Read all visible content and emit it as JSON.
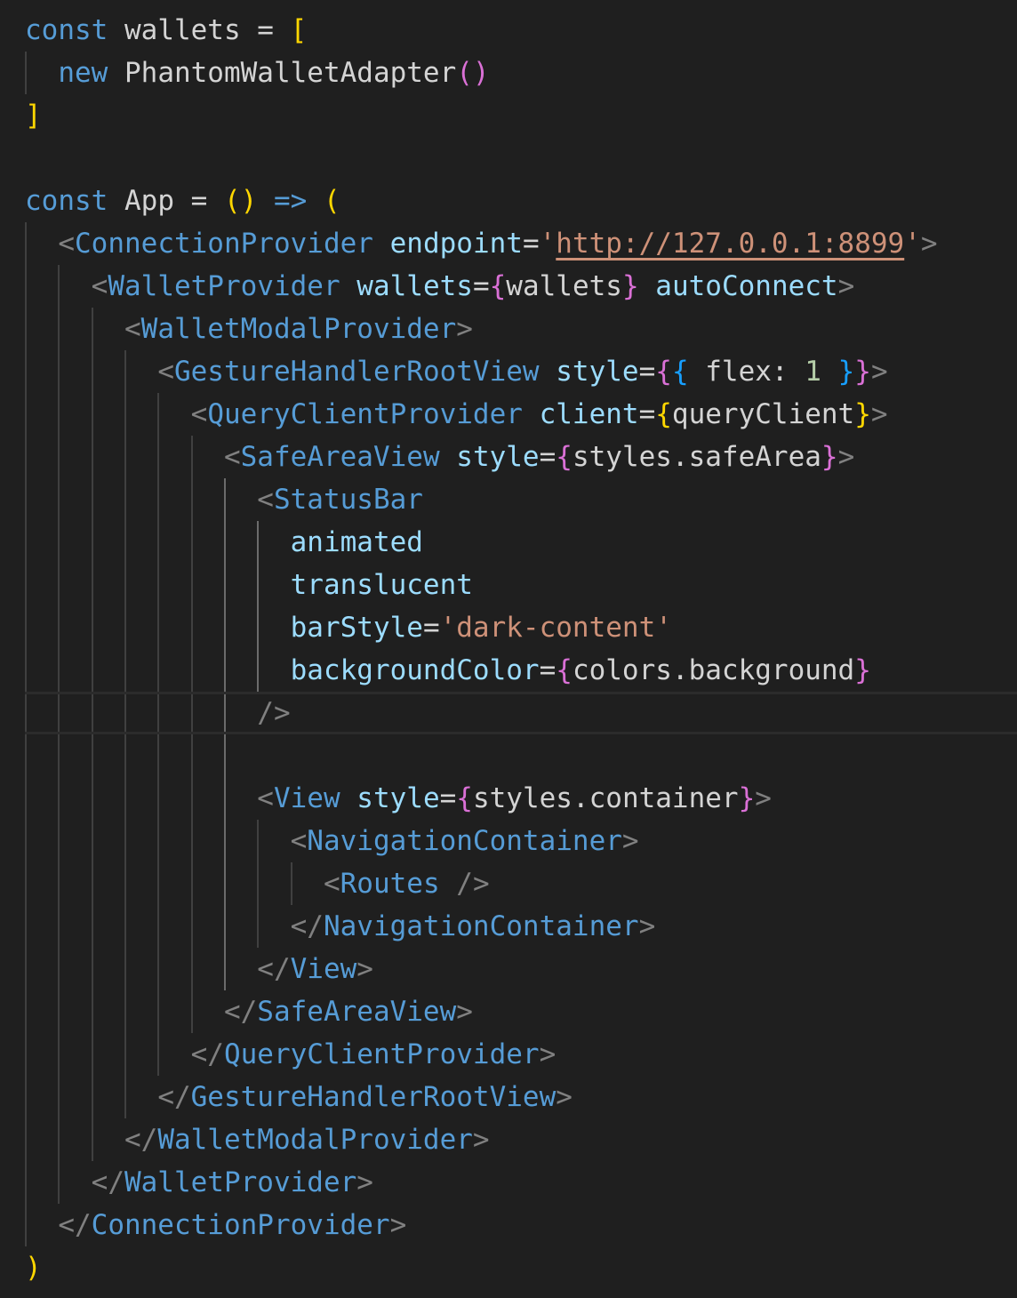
{
  "editor": {
    "theme_colors": {
      "background": "#1f1f1f",
      "keyword": "#569cd6",
      "tag": "#569cd6",
      "attribute": "#9cdcfe",
      "string": "#ce9178",
      "bracket_level1": "#ffd700",
      "bracket_level2": "#da70d6",
      "bracket_level3": "#179fff",
      "number": "#b5cea8",
      "punctuation": "#808080",
      "text": "#d4d4d4"
    },
    "current_line": 17,
    "lines": [
      {
        "tokens": [
          {
            "t": "kw",
            "v": "const"
          },
          {
            "t": "plain",
            "v": " wallets = "
          },
          {
            "t": "br1",
            "v": "["
          }
        ]
      },
      {
        "tokens": [
          {
            "t": "plain",
            "v": "  "
          },
          {
            "t": "kw",
            "v": "new"
          },
          {
            "t": "plain",
            "v": " PhantomWalletAdapter"
          },
          {
            "t": "br2",
            "v": "()"
          }
        ]
      },
      {
        "tokens": [
          {
            "t": "br1",
            "v": "]"
          }
        ]
      },
      {
        "tokens": []
      },
      {
        "tokens": [
          {
            "t": "kw",
            "v": "const"
          },
          {
            "t": "plain",
            "v": " App = "
          },
          {
            "t": "br1",
            "v": "()"
          },
          {
            "t": "kw",
            "v": " =>"
          },
          {
            "t": "plain",
            "v": " "
          },
          {
            "t": "br1",
            "v": "("
          }
        ]
      },
      {
        "tokens": [
          {
            "t": "plain",
            "v": "  "
          },
          {
            "t": "punct",
            "v": "<"
          },
          {
            "t": "tag",
            "v": "ConnectionProvider"
          },
          {
            "t": "plain",
            "v": " "
          },
          {
            "t": "attr",
            "v": "endpoint"
          },
          {
            "t": "plain",
            "v": "="
          },
          {
            "t": "str",
            "v": "'"
          },
          {
            "t": "str-u",
            "v": "http://127.0.0.1:8899"
          },
          {
            "t": "str",
            "v": "'"
          },
          {
            "t": "punct",
            "v": ">"
          }
        ]
      },
      {
        "tokens": [
          {
            "t": "plain",
            "v": "    "
          },
          {
            "t": "punct",
            "v": "<"
          },
          {
            "t": "tag",
            "v": "WalletProvider"
          },
          {
            "t": "plain",
            "v": " "
          },
          {
            "t": "attr",
            "v": "wallets"
          },
          {
            "t": "plain",
            "v": "="
          },
          {
            "t": "br2",
            "v": "{"
          },
          {
            "t": "plain",
            "v": "wallets"
          },
          {
            "t": "br2",
            "v": "}"
          },
          {
            "t": "plain",
            "v": " "
          },
          {
            "t": "attr",
            "v": "autoConnect"
          },
          {
            "t": "punct",
            "v": ">"
          }
        ]
      },
      {
        "tokens": [
          {
            "t": "plain",
            "v": "      "
          },
          {
            "t": "punct",
            "v": "<"
          },
          {
            "t": "tag",
            "v": "WalletModalProvider"
          },
          {
            "t": "punct",
            "v": ">"
          }
        ]
      },
      {
        "tokens": [
          {
            "t": "plain",
            "v": "        "
          },
          {
            "t": "punct",
            "v": "<"
          },
          {
            "t": "tag",
            "v": "GestureHandlerRootView"
          },
          {
            "t": "plain",
            "v": " "
          },
          {
            "t": "attr",
            "v": "style"
          },
          {
            "t": "plain",
            "v": "="
          },
          {
            "t": "br2",
            "v": "{"
          },
          {
            "t": "br3",
            "v": "{"
          },
          {
            "t": "plain",
            "v": " flex: "
          },
          {
            "t": "num",
            "v": "1"
          },
          {
            "t": "plain",
            "v": " "
          },
          {
            "t": "br3",
            "v": "}"
          },
          {
            "t": "br2",
            "v": "}"
          },
          {
            "t": "punct",
            "v": ">"
          }
        ]
      },
      {
        "tokens": [
          {
            "t": "plain",
            "v": "          "
          },
          {
            "t": "punct",
            "v": "<"
          },
          {
            "t": "tag",
            "v": "QueryClientProvider"
          },
          {
            "t": "plain",
            "v": " "
          },
          {
            "t": "attr",
            "v": "client"
          },
          {
            "t": "plain",
            "v": "="
          },
          {
            "t": "br1",
            "v": "{"
          },
          {
            "t": "plain",
            "v": "queryClient"
          },
          {
            "t": "br1",
            "v": "}"
          },
          {
            "t": "punct",
            "v": ">"
          }
        ]
      },
      {
        "tokens": [
          {
            "t": "plain",
            "v": "            "
          },
          {
            "t": "punct",
            "v": "<"
          },
          {
            "t": "tag",
            "v": "SafeAreaView"
          },
          {
            "t": "plain",
            "v": " "
          },
          {
            "t": "attr",
            "v": "style"
          },
          {
            "t": "plain",
            "v": "="
          },
          {
            "t": "br2",
            "v": "{"
          },
          {
            "t": "plain",
            "v": "styles.safeArea"
          },
          {
            "t": "br2",
            "v": "}"
          },
          {
            "t": "punct",
            "v": ">"
          }
        ]
      },
      {
        "tokens": [
          {
            "t": "plain",
            "v": "              "
          },
          {
            "t": "punct",
            "v": "<"
          },
          {
            "t": "tag",
            "v": "StatusBar"
          }
        ]
      },
      {
        "tokens": [
          {
            "t": "plain",
            "v": "                "
          },
          {
            "t": "attr",
            "v": "animated"
          }
        ]
      },
      {
        "tokens": [
          {
            "t": "plain",
            "v": "                "
          },
          {
            "t": "attr",
            "v": "translucent"
          }
        ]
      },
      {
        "tokens": [
          {
            "t": "plain",
            "v": "                "
          },
          {
            "t": "attr",
            "v": "barStyle"
          },
          {
            "t": "plain",
            "v": "="
          },
          {
            "t": "str",
            "v": "'dark-content'"
          }
        ]
      },
      {
        "tokens": [
          {
            "t": "plain",
            "v": "                "
          },
          {
            "t": "attr",
            "v": "backgroundColor"
          },
          {
            "t": "plain",
            "v": "="
          },
          {
            "t": "br2",
            "v": "{"
          },
          {
            "t": "plain",
            "v": "colors.background"
          },
          {
            "t": "br2",
            "v": "}"
          }
        ]
      },
      {
        "tokens": [
          {
            "t": "plain",
            "v": "              "
          },
          {
            "t": "punct",
            "v": "/>"
          }
        ]
      },
      {
        "tokens": []
      },
      {
        "tokens": [
          {
            "t": "plain",
            "v": "              "
          },
          {
            "t": "punct",
            "v": "<"
          },
          {
            "t": "tag",
            "v": "View"
          },
          {
            "t": "plain",
            "v": " "
          },
          {
            "t": "attr",
            "v": "style"
          },
          {
            "t": "plain",
            "v": "="
          },
          {
            "t": "br2",
            "v": "{"
          },
          {
            "t": "plain",
            "v": "styles.container"
          },
          {
            "t": "br2",
            "v": "}"
          },
          {
            "t": "punct",
            "v": ">"
          }
        ]
      },
      {
        "tokens": [
          {
            "t": "plain",
            "v": "                "
          },
          {
            "t": "punct",
            "v": "<"
          },
          {
            "t": "tag",
            "v": "NavigationContainer"
          },
          {
            "t": "punct",
            "v": ">"
          }
        ]
      },
      {
        "tokens": [
          {
            "t": "plain",
            "v": "                  "
          },
          {
            "t": "punct",
            "v": "<"
          },
          {
            "t": "tag",
            "v": "Routes"
          },
          {
            "t": "plain",
            "v": " "
          },
          {
            "t": "punct",
            "v": "/>"
          }
        ]
      },
      {
        "tokens": [
          {
            "t": "plain",
            "v": "                "
          },
          {
            "t": "punct",
            "v": "</"
          },
          {
            "t": "tag",
            "v": "NavigationContainer"
          },
          {
            "t": "punct",
            "v": ">"
          }
        ]
      },
      {
        "tokens": [
          {
            "t": "plain",
            "v": "              "
          },
          {
            "t": "punct",
            "v": "</"
          },
          {
            "t": "tag",
            "v": "View"
          },
          {
            "t": "punct",
            "v": ">"
          }
        ]
      },
      {
        "tokens": [
          {
            "t": "plain",
            "v": "            "
          },
          {
            "t": "punct",
            "v": "</"
          },
          {
            "t": "tag",
            "v": "SafeAreaView"
          },
          {
            "t": "punct",
            "v": ">"
          }
        ]
      },
      {
        "tokens": [
          {
            "t": "plain",
            "v": "          "
          },
          {
            "t": "punct",
            "v": "</"
          },
          {
            "t": "tag",
            "v": "QueryClientProvider"
          },
          {
            "t": "punct",
            "v": ">"
          }
        ]
      },
      {
        "tokens": [
          {
            "t": "plain",
            "v": "        "
          },
          {
            "t": "punct",
            "v": "</"
          },
          {
            "t": "tag",
            "v": "GestureHandlerRootView"
          },
          {
            "t": "punct",
            "v": ">"
          }
        ]
      },
      {
        "tokens": [
          {
            "t": "plain",
            "v": "      "
          },
          {
            "t": "punct",
            "v": "</"
          },
          {
            "t": "tag",
            "v": "WalletModalProvider"
          },
          {
            "t": "punct",
            "v": ">"
          }
        ]
      },
      {
        "tokens": [
          {
            "t": "plain",
            "v": "    "
          },
          {
            "t": "punct",
            "v": "</"
          },
          {
            "t": "tag",
            "v": "WalletProvider"
          },
          {
            "t": "punct",
            "v": ">"
          }
        ]
      },
      {
        "tokens": [
          {
            "t": "plain",
            "v": "  "
          },
          {
            "t": "punct",
            "v": "</"
          },
          {
            "t": "tag",
            "v": "ConnectionProvider"
          },
          {
            "t": "punct",
            "v": ">"
          }
        ]
      },
      {
        "tokens": [
          {
            "t": "br1",
            "v": ")"
          }
        ]
      }
    ]
  }
}
